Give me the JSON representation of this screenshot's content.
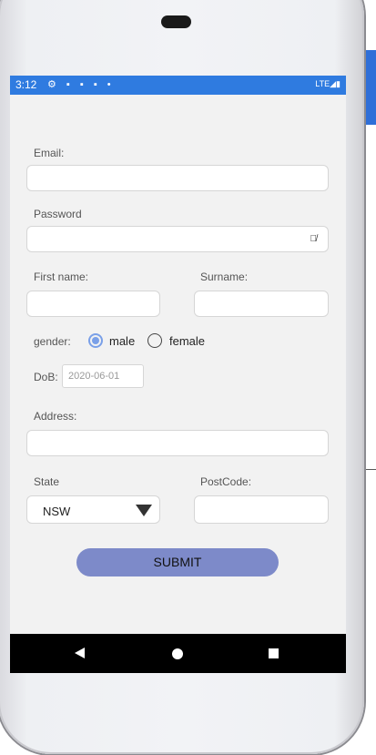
{
  "status_bar": {
    "time": "3:12",
    "icons": "⚙ ▪ ▪ ▪ •",
    "network": "LTE◢▮"
  },
  "form": {
    "email_label": "Email:",
    "email_value": "",
    "password_label": "Password",
    "password_value": "",
    "first_name_label": "First name:",
    "surname_label": "Surname:",
    "gender_label": "gender:",
    "gender_options": [
      "male",
      "female"
    ],
    "gender_selected": "male",
    "dob_label": "DoB:",
    "dob_value": "2020-06-01",
    "address_label": "Address:",
    "state_label": "State",
    "state_value": "NSW",
    "postcode_label": "PostCode:",
    "submit_label": "SUBMIT"
  },
  "colors": {
    "status_bar": "#2f7be0",
    "submit_button": "#7d8ac9",
    "radio_selected": "#7aa0e8"
  },
  "icons": {
    "password_toggle": "eye-off-icon",
    "nav_back": "back-triangle-icon",
    "nav_home": "home-circle-icon",
    "nav_recent": "recent-square-icon"
  }
}
